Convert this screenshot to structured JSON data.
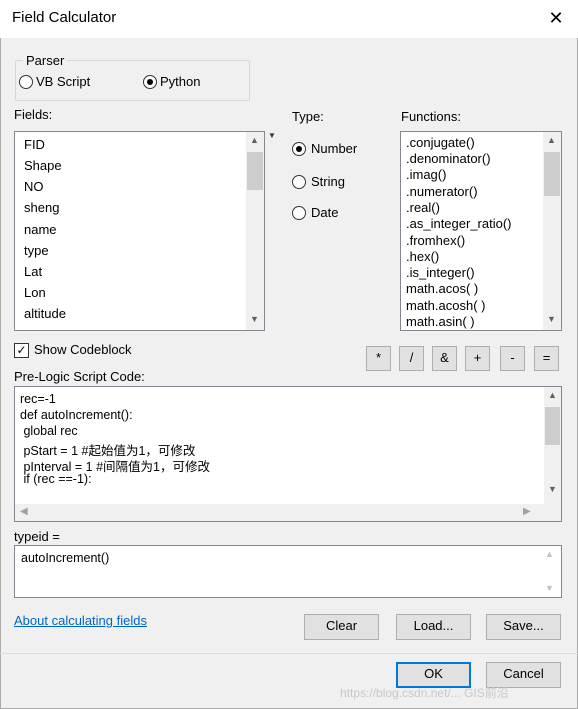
{
  "window": {
    "title": "Field Calculator",
    "close_glyph": "✕"
  },
  "parser": {
    "group_label": "Parser",
    "options": [
      {
        "label": "VB Script",
        "selected": false
      },
      {
        "label": "Python",
        "selected": true
      }
    ]
  },
  "fields": {
    "label": "Fields:",
    "items": [
      "FID",
      "Shape",
      "NO",
      "sheng",
      "name",
      "type",
      "Lat",
      "Lon",
      "altitude"
    ]
  },
  "type": {
    "label": "Type:",
    "options": [
      {
        "label": "Number",
        "selected": true
      },
      {
        "label": "String",
        "selected": false
      },
      {
        "label": "Date",
        "selected": false
      }
    ]
  },
  "functions": {
    "label": "Functions:",
    "items": [
      ".conjugate()",
      ".denominator()",
      ".imag()",
      ".numerator()",
      ".real()",
      ".as_integer_ratio()",
      ".fromhex()",
      ".hex()",
      ".is_integer()",
      "math.acos( )",
      "math.acosh( )",
      "math.asin( )"
    ]
  },
  "show_codeblock": {
    "label": "Show Codeblock",
    "checked": true
  },
  "operators": [
    "*",
    "/",
    "&",
    "+",
    "-",
    "="
  ],
  "prelogic": {
    "label": "Pre-Logic Script Code:",
    "lines": [
      "rec=-1",
      "def autoIncrement():",
      " global rec",
      " pStart = 1 #起始值为1，可修改",
      " pInterval = 1 #间隔值为1，可修改",
      " if (rec ==-1):"
    ]
  },
  "expression": {
    "label": "typeid =",
    "value": "autoIncrement()"
  },
  "about_link": "About calculating fields",
  "buttons": {
    "clear": "Clear",
    "load": "Load...",
    "save": "Save...",
    "ok": "OK",
    "cancel": "Cancel"
  },
  "watermark": "https://blog.csdn.net/...  GIS前沿",
  "colors": {
    "accent": "#0078d7",
    "link": "#0066cc"
  }
}
